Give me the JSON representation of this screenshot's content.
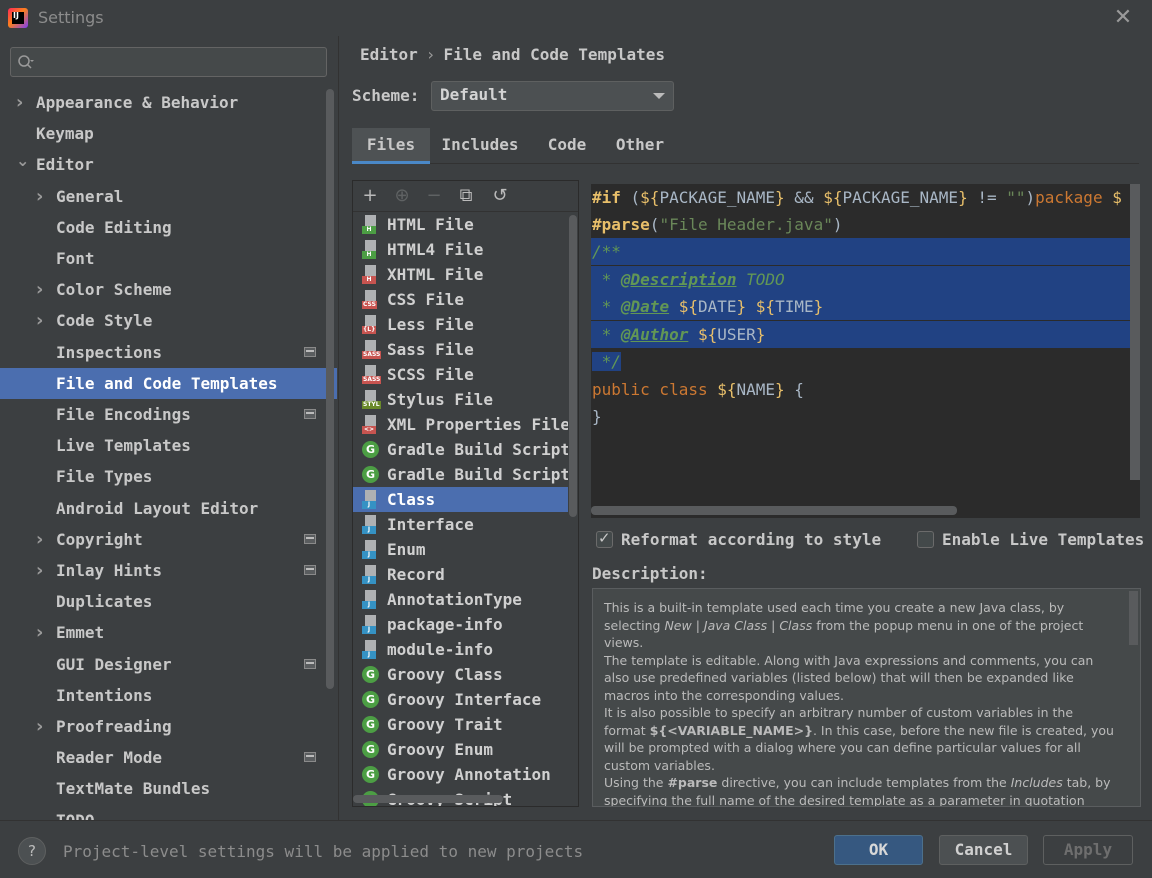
{
  "window": {
    "title": "Settings"
  },
  "search": {
    "placeholder": ""
  },
  "sidebar": {
    "items": [
      {
        "label": "Appearance & Behavior",
        "level": 0,
        "expander": "collapsed"
      },
      {
        "label": "Keymap",
        "level": 0,
        "expander": "none"
      },
      {
        "label": "Editor",
        "level": 0,
        "expander": "expanded"
      },
      {
        "label": "General",
        "level": 1,
        "expander": "collapsed"
      },
      {
        "label": "Code Editing",
        "level": 1,
        "expander": "none"
      },
      {
        "label": "Font",
        "level": 1,
        "expander": "none"
      },
      {
        "label": "Color Scheme",
        "level": 1,
        "expander": "collapsed"
      },
      {
        "label": "Code Style",
        "level": 1,
        "expander": "collapsed"
      },
      {
        "label": "Inspections",
        "level": 1,
        "expander": "none",
        "project_icon": true
      },
      {
        "label": "File and Code Templates",
        "level": 1,
        "expander": "none",
        "selected": true
      },
      {
        "label": "File Encodings",
        "level": 1,
        "expander": "none",
        "project_icon": true
      },
      {
        "label": "Live Templates",
        "level": 1,
        "expander": "none"
      },
      {
        "label": "File Types",
        "level": 1,
        "expander": "none"
      },
      {
        "label": "Android Layout Editor",
        "level": 1,
        "expander": "none"
      },
      {
        "label": "Copyright",
        "level": 1,
        "expander": "collapsed",
        "project_icon": true
      },
      {
        "label": "Inlay Hints",
        "level": 1,
        "expander": "collapsed",
        "project_icon": true
      },
      {
        "label": "Duplicates",
        "level": 1,
        "expander": "none"
      },
      {
        "label": "Emmet",
        "level": 1,
        "expander": "collapsed"
      },
      {
        "label": "GUI Designer",
        "level": 1,
        "expander": "none",
        "project_icon": true
      },
      {
        "label": "Intentions",
        "level": 1,
        "expander": "none"
      },
      {
        "label": "Proofreading",
        "level": 1,
        "expander": "collapsed"
      },
      {
        "label": "Reader Mode",
        "level": 1,
        "expander": "none",
        "project_icon": true
      },
      {
        "label": "TextMate Bundles",
        "level": 1,
        "expander": "none"
      },
      {
        "label": "TODO",
        "level": 1,
        "expander": "none"
      }
    ]
  },
  "breadcrumb": {
    "parent": "Editor",
    "separator": "›",
    "current": "File and Code Templates"
  },
  "scheme": {
    "label": "Scheme:",
    "value": "Default"
  },
  "tabs": [
    {
      "label": "Files",
      "active": true
    },
    {
      "label": "Includes"
    },
    {
      "label": "Code"
    },
    {
      "label": "Other"
    }
  ],
  "toolbar": {
    "add": "+",
    "add_child": "⊕",
    "remove": "−",
    "copy": "⧉",
    "reset": "↺"
  },
  "templates": [
    {
      "label": "HTML File",
      "icon": "file",
      "tag": "H",
      "tag_color": "#4c9e44"
    },
    {
      "label": "HTML4 File",
      "icon": "file",
      "tag": "H",
      "tag_color": "#4c9e44"
    },
    {
      "label": "XHTML File",
      "icon": "file",
      "tag": "H",
      "tag_color": "#c75450"
    },
    {
      "label": "CSS File",
      "icon": "file",
      "tag": "CSS",
      "tag_color": "#c75450"
    },
    {
      "label": "Less File",
      "icon": "file",
      "tag": "{L}",
      "tag_color": "#c75450"
    },
    {
      "label": "Sass File",
      "icon": "file",
      "tag": "SASS",
      "tag_color": "#c75450"
    },
    {
      "label": "SCSS File",
      "icon": "file",
      "tag": "SASS",
      "tag_color": "#c75450"
    },
    {
      "label": "Stylus File",
      "icon": "file",
      "tag": "STYL",
      "tag_color": "#6a8a2a"
    },
    {
      "label": "XML Properties File",
      "icon": "file",
      "tag": "<>",
      "tag_color": "#c75450"
    },
    {
      "label": "Gradle Build Script",
      "icon": "gradle"
    },
    {
      "label": "Gradle Build Script w",
      "icon": "gradle"
    },
    {
      "label": "Class",
      "icon": "file",
      "tag": "J",
      "tag_color": "#3592c4",
      "selected": true
    },
    {
      "label": "Interface",
      "icon": "file",
      "tag": "J",
      "tag_color": "#3592c4"
    },
    {
      "label": "Enum",
      "icon": "file",
      "tag": "J",
      "tag_color": "#3592c4"
    },
    {
      "label": "Record",
      "icon": "file",
      "tag": "J",
      "tag_color": "#3592c4"
    },
    {
      "label": "AnnotationType",
      "icon": "file",
      "tag": "J",
      "tag_color": "#3592c4"
    },
    {
      "label": "package-info",
      "icon": "file",
      "tag": "J",
      "tag_color": "#3592c4"
    },
    {
      "label": "module-info",
      "icon": "file",
      "tag": "J",
      "tag_color": "#3592c4"
    },
    {
      "label": "Groovy Class",
      "icon": "groovy"
    },
    {
      "label": "Groovy Interface",
      "icon": "groovy"
    },
    {
      "label": "Groovy Trait",
      "icon": "groovy"
    },
    {
      "label": "Groovy Enum",
      "icon": "groovy"
    },
    {
      "label": "Groovy Annotation",
      "icon": "groovy"
    },
    {
      "label": "Groovy Script",
      "icon": "groovy"
    }
  ],
  "code": [
    {
      "selected": false,
      "tokens": [
        [
          "dir",
          "#if"
        ],
        [
          "plain",
          " ("
        ],
        [
          "var",
          "${"
        ],
        [
          "plain",
          "PACKAGE_NAME"
        ],
        [
          "var",
          "}"
        ],
        [
          "plain",
          " && "
        ],
        [
          "var",
          "${"
        ],
        [
          "plain",
          "PACKAGE_NAME"
        ],
        [
          "var",
          "}"
        ],
        [
          "plain",
          " != "
        ],
        [
          "str",
          "\"\""
        ],
        [
          "plain",
          ")"
        ],
        [
          "kw",
          "package"
        ],
        [
          "plain",
          " "
        ],
        [
          "var",
          "$"
        ]
      ]
    },
    {
      "selected": false,
      "tokens": [
        [
          "dir",
          "#parse"
        ],
        [
          "plain",
          "("
        ],
        [
          "str",
          "\"File Header.java\""
        ],
        [
          "plain",
          ")"
        ]
      ]
    },
    {
      "selected": true,
      "tokens": [
        [
          "doc",
          "/**"
        ]
      ]
    },
    {
      "selected": true,
      "tokens": [
        [
          "doc",
          " * "
        ],
        [
          "doctag",
          "@Description"
        ],
        [
          "doc",
          " TODO"
        ]
      ]
    },
    {
      "selected": true,
      "tokens": [
        [
          "doc",
          " * "
        ],
        [
          "doctag",
          "@Date"
        ],
        [
          "plain",
          " "
        ],
        [
          "var",
          "${"
        ],
        [
          "plain",
          "DATE"
        ],
        [
          "var",
          "}"
        ],
        [
          "plain",
          " "
        ],
        [
          "var",
          "${"
        ],
        [
          "plain",
          "TIME"
        ],
        [
          "var",
          "}"
        ]
      ]
    },
    {
      "selected": true,
      "tokens": [
        [
          "doc",
          " * "
        ],
        [
          "doctag",
          "@Author"
        ],
        [
          "plain",
          " "
        ],
        [
          "var",
          "${"
        ],
        [
          "plain",
          "USER"
        ],
        [
          "var",
          "}"
        ]
      ]
    },
    {
      "selected": "partial",
      "tokens": [
        [
          "doc",
          " */"
        ]
      ]
    },
    {
      "selected": false,
      "tokens": [
        [
          "kw",
          "public class "
        ],
        [
          "var",
          "${"
        ],
        [
          "plain",
          "NAME"
        ],
        [
          "var",
          "}"
        ],
        [
          "plain",
          " {"
        ]
      ]
    },
    {
      "selected": false,
      "tokens": [
        [
          "plain",
          "}"
        ]
      ]
    }
  ],
  "options": {
    "reformat": {
      "label": "Reformat according to style",
      "checked": true
    },
    "live_templates": {
      "label": "Enable Live Templates",
      "checked": false
    }
  },
  "description": {
    "label": "Description:",
    "paragraphs": [
      [
        [
          "t",
          "This is a built-in template used each time you create a new Java class, by selecting "
        ],
        [
          "i",
          "New"
        ],
        [
          "t",
          " | "
        ],
        [
          "i",
          "Java Class"
        ],
        [
          "t",
          " | "
        ],
        [
          "i",
          "Class"
        ],
        [
          "t",
          " from the popup menu in one of the project views."
        ]
      ],
      [
        [
          "t",
          "The template is editable. Along with Java expressions and comments, you can also use predefined variables (listed below) that will then be expanded like macros into the corresponding values."
        ]
      ],
      [
        [
          "t",
          "It is also possible to specify an arbitrary number of custom variables in the format "
        ],
        [
          "b",
          "${<VARIABLE_NAME>}"
        ],
        [
          "t",
          ". In this case, before the new file is created, you will be prompted with a dialog where you can define particular values for all custom variables."
        ]
      ],
      [
        [
          "t",
          "Using the "
        ],
        [
          "b",
          "#parse"
        ],
        [
          "t",
          " directive, you can include templates from the "
        ],
        [
          "i",
          "Includes"
        ],
        [
          "t",
          " tab, by specifying the full name of the desired template as a parameter in quotation marks."
        ]
      ]
    ]
  },
  "footer": {
    "help": "?",
    "note": "Project-level settings will be applied to new projects",
    "ok": "OK",
    "cancel": "Cancel",
    "apply": "Apply"
  }
}
